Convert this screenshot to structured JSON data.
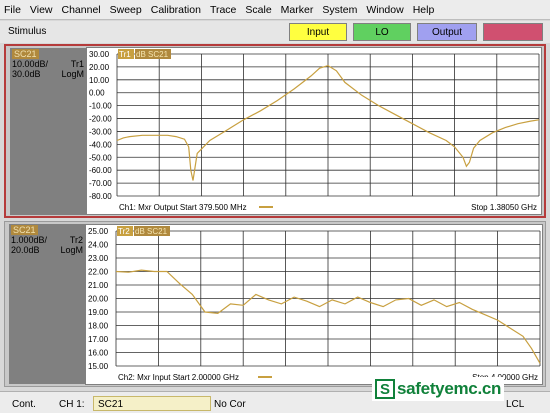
{
  "menu": [
    "File",
    "View",
    "Channel",
    "Sweep",
    "Calibration",
    "Trace",
    "Scale",
    "Marker",
    "System",
    "Window",
    "Help"
  ],
  "softbar": {
    "label": "Stimulus",
    "keys": [
      {
        "label": "Input",
        "color": "#ffff40"
      },
      {
        "label": "LO",
        "color": "#60d060"
      },
      {
        "label": "Output",
        "color": "#a0a0f0"
      },
      {
        "label": "",
        "color": "#d05070"
      }
    ]
  },
  "trace_color": "#c8a040",
  "window1": {
    "trace_name": "SC21",
    "scale": "10.00dB/",
    "trace_id": "Tr1",
    "ref": "30.0dB",
    "format": "LogM",
    "legend_tag": "Tr1",
    "legend_text": "dB SC21",
    "footer_start": "Ch1: Mxr Output  Start  379.500 MHz",
    "footer_stop": "Stop  1.38050 GHz"
  },
  "window2": {
    "trace_name": "SC21",
    "scale": "1.000dB/",
    "trace_id": "Tr2",
    "ref": "20.0dB",
    "format": "LogM",
    "legend_tag": "Tr2",
    "legend_text": "dB SC21",
    "footer_start": "Ch2: Mxr Input  Start  2.00000 GHz",
    "footer_stop": "Stop  4.00000 GHz"
  },
  "chart_data": [
    {
      "type": "line",
      "ylim": [
        -80,
        30
      ],
      "y_ticks": [
        "30.00",
        "20.00",
        "10.00",
        "0.00",
        "-10.00",
        "-20.00",
        "-30.00",
        "-40.00",
        "-50.00",
        "-60.00",
        "-70.00",
        "-80.00"
      ],
      "x_divisions": 10,
      "grid": true,
      "series": [
        {
          "x": [
            0,
            0.15,
            0.3,
            0.6,
            0.9,
            1.2,
            1.4,
            1.6,
            1.7,
            1.75,
            1.8,
            1.9,
            2.2,
            2.6,
            3.0,
            3.4,
            3.8,
            4.2,
            4.6,
            4.8,
            5.0,
            5.2,
            5.4,
            5.8,
            6.2,
            6.6,
            7.0,
            7.4,
            7.8,
            8.0,
            8.2,
            8.28,
            8.35,
            8.45,
            8.6,
            8.9,
            9.2,
            9.5,
            9.8,
            10.0
          ],
          "y": [
            -37,
            -35,
            -34,
            -33,
            -33,
            -33,
            -34,
            -36,
            -42,
            -60,
            -68,
            -47,
            -37,
            -29,
            -21,
            -14,
            -6,
            3,
            13,
            19,
            21,
            17,
            8,
            -2,
            -10,
            -17,
            -24,
            -31,
            -37,
            -42,
            -50,
            -57,
            -54,
            -43,
            -37,
            -31,
            -27,
            -24,
            -22,
            -21
          ]
        }
      ]
    },
    {
      "type": "line",
      "ylim": [
        15,
        25
      ],
      "y_ticks": [
        "25.00",
        "24.00",
        "23.00",
        "22.00",
        "21.00",
        "20.00",
        "19.00",
        "18.00",
        "17.00",
        "16.00",
        "15.00"
      ],
      "x_divisions": 10,
      "grid": true,
      "series": [
        {
          "x": [
            0,
            0.3,
            0.6,
            0.9,
            1.2,
            1.5,
            1.8,
            2.1,
            2.4,
            2.7,
            3.0,
            3.3,
            3.6,
            3.9,
            4.2,
            4.5,
            4.8,
            5.1,
            5.4,
            5.7,
            6.0,
            6.3,
            6.6,
            6.9,
            7.2,
            7.5,
            7.8,
            8.1,
            8.4,
            8.7,
            9.0,
            9.3,
            9.6,
            9.8,
            10.0
          ],
          "y": [
            22.0,
            21.95,
            22.1,
            22.0,
            22.0,
            21.1,
            20.3,
            19.0,
            18.9,
            19.6,
            19.5,
            20.3,
            19.9,
            19.6,
            20.1,
            19.8,
            19.4,
            19.9,
            19.6,
            20.1,
            19.7,
            19.4,
            19.9,
            20.0,
            19.5,
            19.9,
            19.4,
            19.7,
            19.2,
            18.8,
            18.4,
            17.8,
            17.2,
            16.3,
            15.2
          ]
        }
      ]
    }
  ],
  "status": {
    "mode": "Cont.",
    "channel": "CH 1:",
    "param": "SC21",
    "correction": "No Cor",
    "remote": "LCL"
  },
  "logo": {
    "mark": "S",
    "text": "safetyemc.cn"
  }
}
